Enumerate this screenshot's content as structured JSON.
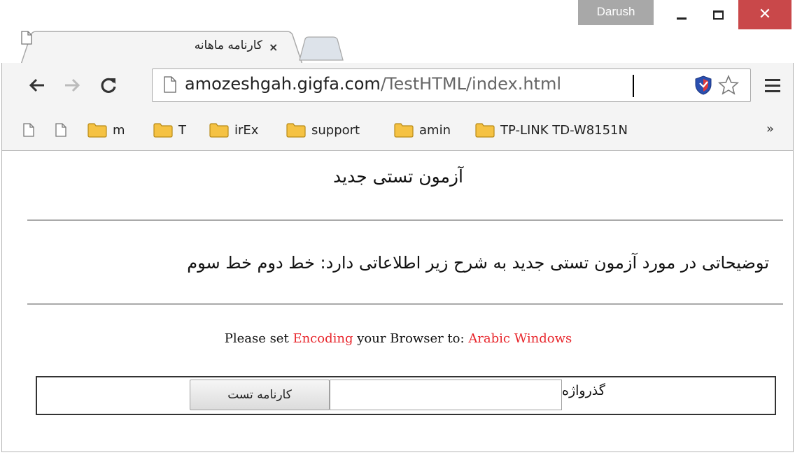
{
  "window": {
    "user": "Darush",
    "colors": {
      "close_button": "#c9484a",
      "user_badge": "#a8a8a8"
    }
  },
  "tab": {
    "title": "کارنامه ماهانه",
    "close_glyph": "×"
  },
  "toolbar": {
    "url_host": "amozeshgah.gigfa.com",
    "url_path": "/TestHTML/index.html"
  },
  "bookmarks": {
    "items": [
      {
        "label": "",
        "icon": "page-icon"
      },
      {
        "label": "",
        "icon": "page-icon"
      },
      {
        "label": "m",
        "icon": "folder-icon"
      },
      {
        "label": "T",
        "icon": "folder-icon"
      },
      {
        "label": "irEx",
        "icon": "folder-icon"
      },
      {
        "label": "support",
        "icon": "folder-icon"
      },
      {
        "label": "amin",
        "icon": "folder-icon"
      },
      {
        "label": "TP-LINK TD-W8151N",
        "icon": "folder-icon"
      }
    ],
    "overflow": "»"
  },
  "page": {
    "heading": "آزمون تستی جدید",
    "description": "توضیحاتی در مورد آزمون تستی جدید به شرح زیر اطلاعاتی دارد: خط دوم خط سوم",
    "encoding": {
      "part1": "Please set",
      "part2": "Encoding",
      "part3": "your Browser to:",
      "part4": "Arabic Windows",
      "accent": "#e8262c"
    },
    "form": {
      "password_label": "گذرواژه",
      "password_value": "",
      "submit_label": "کارنامه تست"
    }
  }
}
